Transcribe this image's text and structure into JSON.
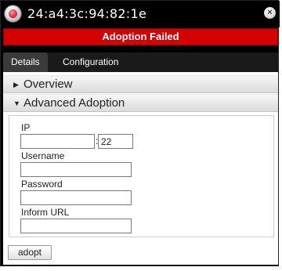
{
  "window": {
    "title": "24:a4:3c:94:82:1e",
    "close_glyph": "×"
  },
  "banner": {
    "text": "Adoption Failed",
    "color": "#d40000"
  },
  "tabs": [
    {
      "label": "Details",
      "active": true
    },
    {
      "label": "Configuration",
      "active": false
    }
  ],
  "sections": {
    "overview": {
      "label": "Overview",
      "expanded": false,
      "arrow": "▶"
    },
    "advanced": {
      "label": "Advanced Adoption",
      "expanded": true,
      "arrow": "▼"
    }
  },
  "form": {
    "ip_label": "IP",
    "ip_value": "",
    "port_separator": ":",
    "port_value": "22",
    "username_label": "Username",
    "username_value": "",
    "password_label": "Password",
    "password_value": "",
    "inform_url_label": "Inform URL",
    "inform_url_value": ""
  },
  "actions": {
    "adopt_label": "adopt"
  }
}
